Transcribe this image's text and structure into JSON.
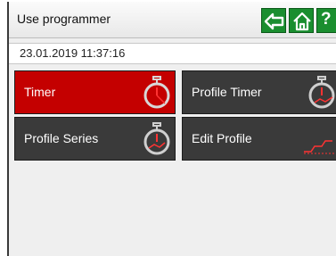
{
  "window": {
    "title": "Use programmer"
  },
  "nav": {
    "help_label": "?"
  },
  "status": {
    "datetime": "23.01.2019 11:37:16"
  },
  "tiles": [
    {
      "label": "Timer",
      "icon": "stopwatch-icon"
    },
    {
      "label": "Profile Timer",
      "icon": "stopwatch-icon"
    },
    {
      "label": "Profile Series",
      "icon": "stopwatch-icon"
    },
    {
      "label": "Edit Profile",
      "icon": "profile-graph-icon"
    }
  ],
  "colors": {
    "active_tile": "#c40000",
    "tile": "#3a3a3a",
    "nav_button": "#1a8e2f"
  }
}
